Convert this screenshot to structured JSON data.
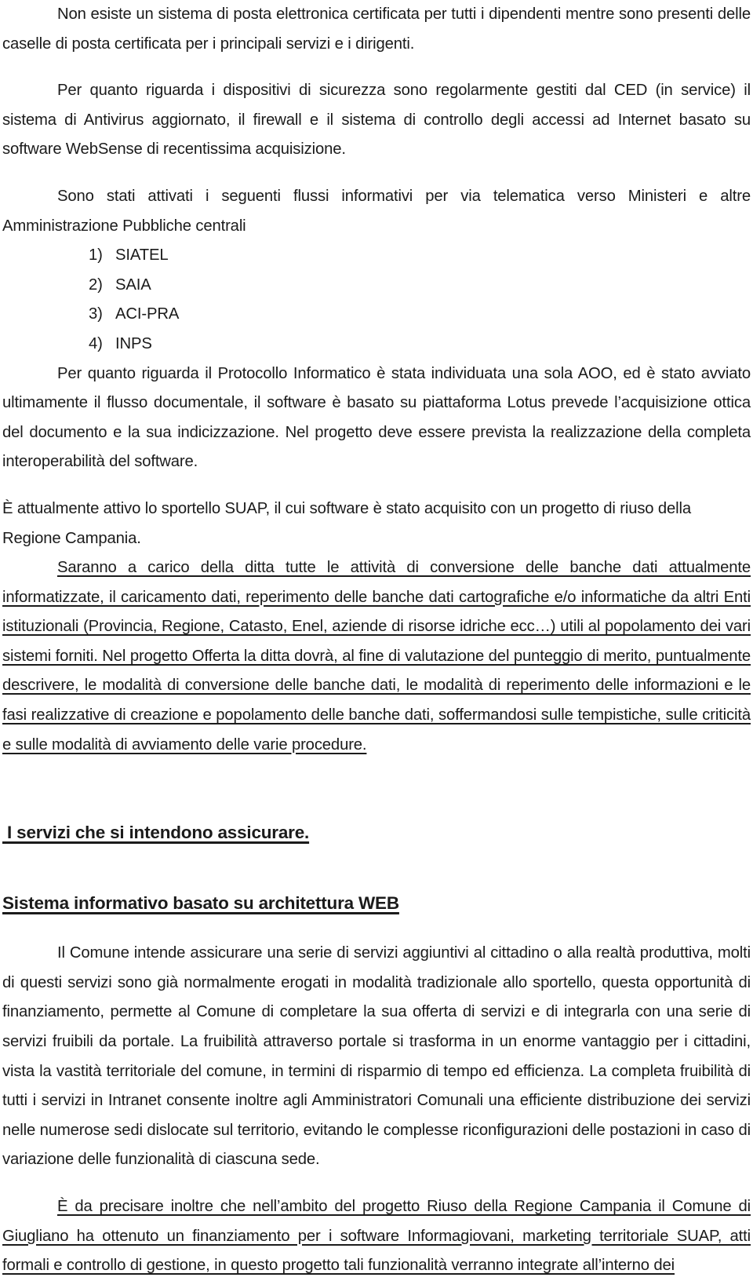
{
  "document": {
    "paragraphs": {
      "p1": "Non esiste un sistema di posta elettronica certificata per tutti i dipendenti mentre sono presenti delle caselle di posta certificata per i principali servizi e i dirigenti.",
      "p2": "Per quanto riguarda i dispositivi di sicurezza sono regolarmente gestiti dal CED (in service) il sistema di Antivirus aggiornato, il firewall e il sistema di controllo degli accessi ad Internet basato su software WebSense di recentissima acquisizione.",
      "p3": "Sono stati attivati i seguenti flussi informativi per via telematica verso Ministeri e altre Amministrazione Pubbliche centrali",
      "p4": "Per quanto riguarda il Protocollo Informatico è stata individuata una sola AOO, ed è stato avviato ultimamente il flusso documentale, il software è basato su piattaforma Lotus prevede l’acquisizione ottica del documento e la sua indicizzazione. Nel progetto deve essere prevista la realizzazione della completa interoperabilità del software.",
      "p5": "È attualmente attivo lo sportello SUAP, il cui software è stato acquisito con un progetto di riuso della Regione Campania.",
      "p6": "Saranno a carico della ditta tutte le attività di conversione delle banche dati attualmente informatizzate, il caricamento dati, reperimento delle banche dati cartografiche e/o informatiche da altri Enti istituzionali (Provincia, Regione, Catasto, Enel, aziende di risorse idriche ecc…) utili al popolamento dei vari sistemi forniti. Nel progetto Offerta la ditta dovrà, al fine di valutazione del punteggio di merito, puntualmente descrivere, le modalità di conversione delle banche dati,  le modalità di reperimento delle informazioni e le fasi realizzative di creazione e popolamento delle banche dati, soffermandosi sulle tempistiche, sulle criticità e sulle modalità di avviamento delle varie procedure.",
      "p7": "Il Comune intende assicurare una serie di servizi aggiuntivi al cittadino o alla realtà produttiva, molti di questi servizi sono già normalmente erogati in modalità tradizionale allo sportello, questa opportunità di finanziamento, permette al Comune di completare la sua offerta di servizi e di integrarla con una serie di servizi fruibili da portale. La fruibilità attraverso portale si trasforma in un enorme vantaggio per i cittadini, vista la vastità territoriale del comune, in termini di risparmio di tempo ed efficienza. La completa fruibilità di tutti i servizi in Intranet consente inoltre agli Amministratori Comunali una efficiente distribuzione dei servizi nelle numerose sedi dislocate sul territorio, evitando le complesse riconfigurazioni delle postazioni in caso di variazione delle funzionalità di ciascuna sede.",
      "p8": "È da precisare inoltre che nell’ambito del progetto Riuso della Regione Campania il Comune di Giugliano ha ottenuto un finanziamento per i software Informagiovani, marketing territoriale SUAP, atti formali e controllo di gestione, in questo progetto tali funzionalità verranno integrate all’interno dei"
    },
    "flux_list": [
      {
        "num": "1)",
        "label": "SIATEL"
      },
      {
        "num": "2)",
        "label": "SAIA"
      },
      {
        "num": "3)",
        "label": "ACI-PRA"
      },
      {
        "num": "4)",
        "label": "INPS"
      }
    ],
    "headings": {
      "h1": " I servizi che si intendono assicurare.",
      "h2": "Sistema informativo basato su architettura WEB"
    },
    "colors": {
      "text": "#1b1b1b",
      "background": "#ffffff"
    }
  }
}
